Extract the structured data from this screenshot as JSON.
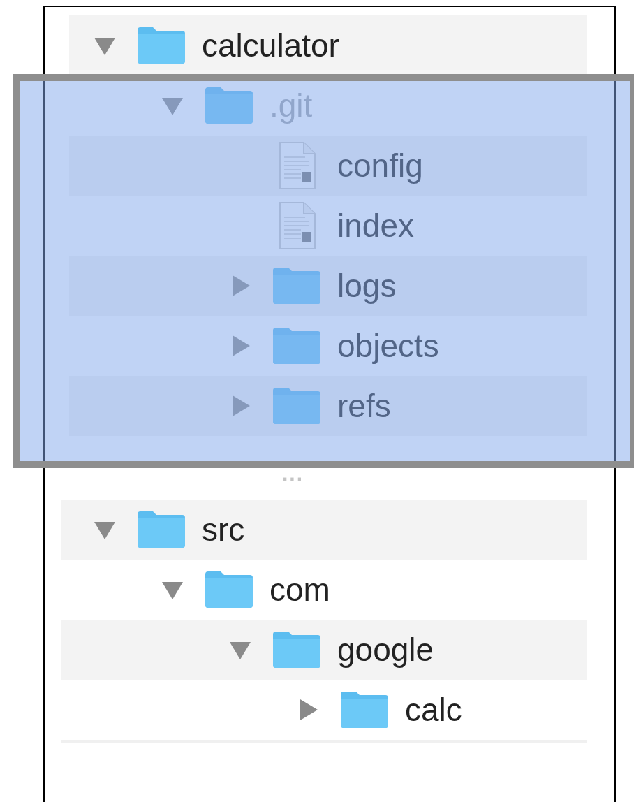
{
  "top_tree": [
    {
      "name": "calculator",
      "kind": "folder",
      "expanded": true,
      "hidden": false,
      "highlighted": false,
      "children": [
        {
          "name": ".git",
          "kind": "folder",
          "expanded": true,
          "hidden": true,
          "highlighted": true,
          "children": [
            {
              "name": "config",
              "kind": "file",
              "hidden": false,
              "highlighted": false
            },
            {
              "name": "index",
              "kind": "file",
              "hidden": false,
              "highlighted": false
            },
            {
              "name": "logs",
              "kind": "folder",
              "expanded": false,
              "hidden": false,
              "highlighted": false
            },
            {
              "name": "objects",
              "kind": "folder",
              "expanded": false,
              "hidden": false,
              "highlighted": false
            },
            {
              "name": "refs",
              "kind": "folder",
              "expanded": false,
              "hidden": false,
              "highlighted": false
            }
          ]
        }
      ]
    }
  ],
  "ellipsis": "...",
  "bottom_tree": [
    {
      "name": "src",
      "kind": "folder",
      "expanded": true,
      "hidden": false,
      "children": [
        {
          "name": "com",
          "kind": "folder",
          "expanded": true,
          "hidden": false,
          "children": [
            {
              "name": "google",
              "kind": "folder",
              "expanded": true,
              "hidden": false,
              "children": [
                {
                  "name": "calc",
                  "kind": "folder",
                  "expanded": false,
                  "hidden": false
                }
              ]
            }
          ]
        }
      ]
    }
  ]
}
